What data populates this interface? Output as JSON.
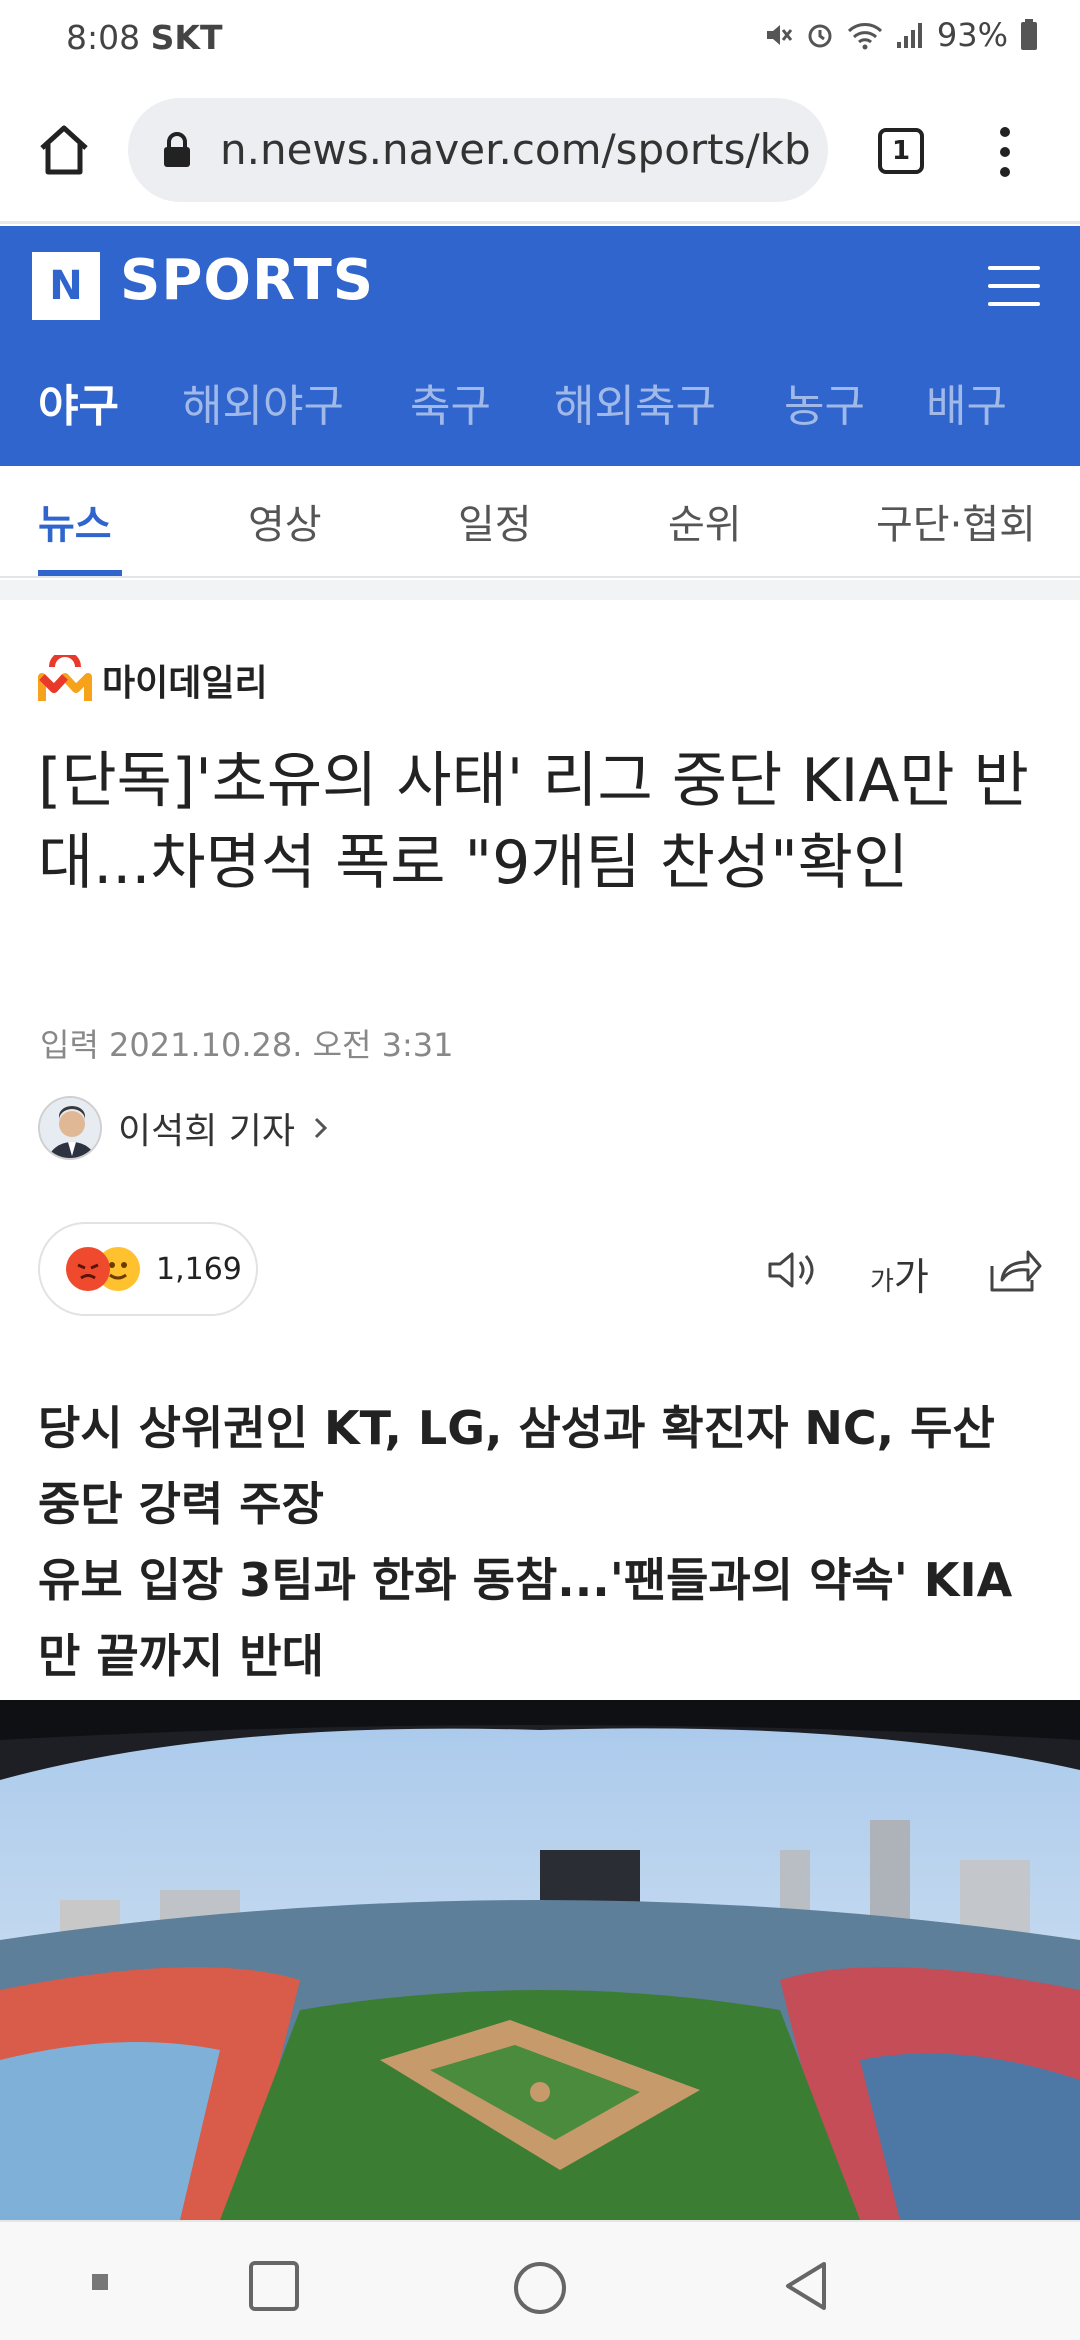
{
  "status_bar": {
    "time": "8:08",
    "carrier": "SKT",
    "battery": "93%"
  },
  "browser": {
    "url": "n.news.naver.com/sports/kb",
    "tab_count": "1"
  },
  "header": {
    "logo_letter": "N",
    "title": "SPORTS"
  },
  "sport_tabs": [
    "야구",
    "해외야구",
    "축구",
    "해외축구",
    "농구",
    "배구"
  ],
  "sub_tabs": [
    "뉴스",
    "영상",
    "일정",
    "순위",
    "구단·협회"
  ],
  "article": {
    "press": "마이데일리",
    "headline": "[단독]'초유의 사태' 리그 중단 KIA만 반대...차명석 폭로 \"9개팀 찬성\"확인",
    "date": "입력 2021.10.28. 오전 3:31",
    "reporter": "이석희 기자",
    "reaction_count": "1,169",
    "font_small": "가",
    "font_large": "가",
    "subtitle_1": "당시 상위권인 KT, LG, 삼성과 확진자 NC, 두산 중단 강력 주장",
    "subtitle_2": "유보 입장 3팀과 한화 동참...'팬들과의 약속' KIA만 끝까지 반대"
  },
  "colors": {
    "brand": "#2f65cc",
    "press_red": "#e8392a",
    "press_orange": "#f7a21b"
  },
  "icons": [
    "home-icon",
    "lock-icon",
    "tabs-icon",
    "more-icon",
    "menu-icon",
    "speaker-icon",
    "font-size-icon",
    "share-icon",
    "recents-icon",
    "home-nav-icon",
    "back-icon"
  ]
}
